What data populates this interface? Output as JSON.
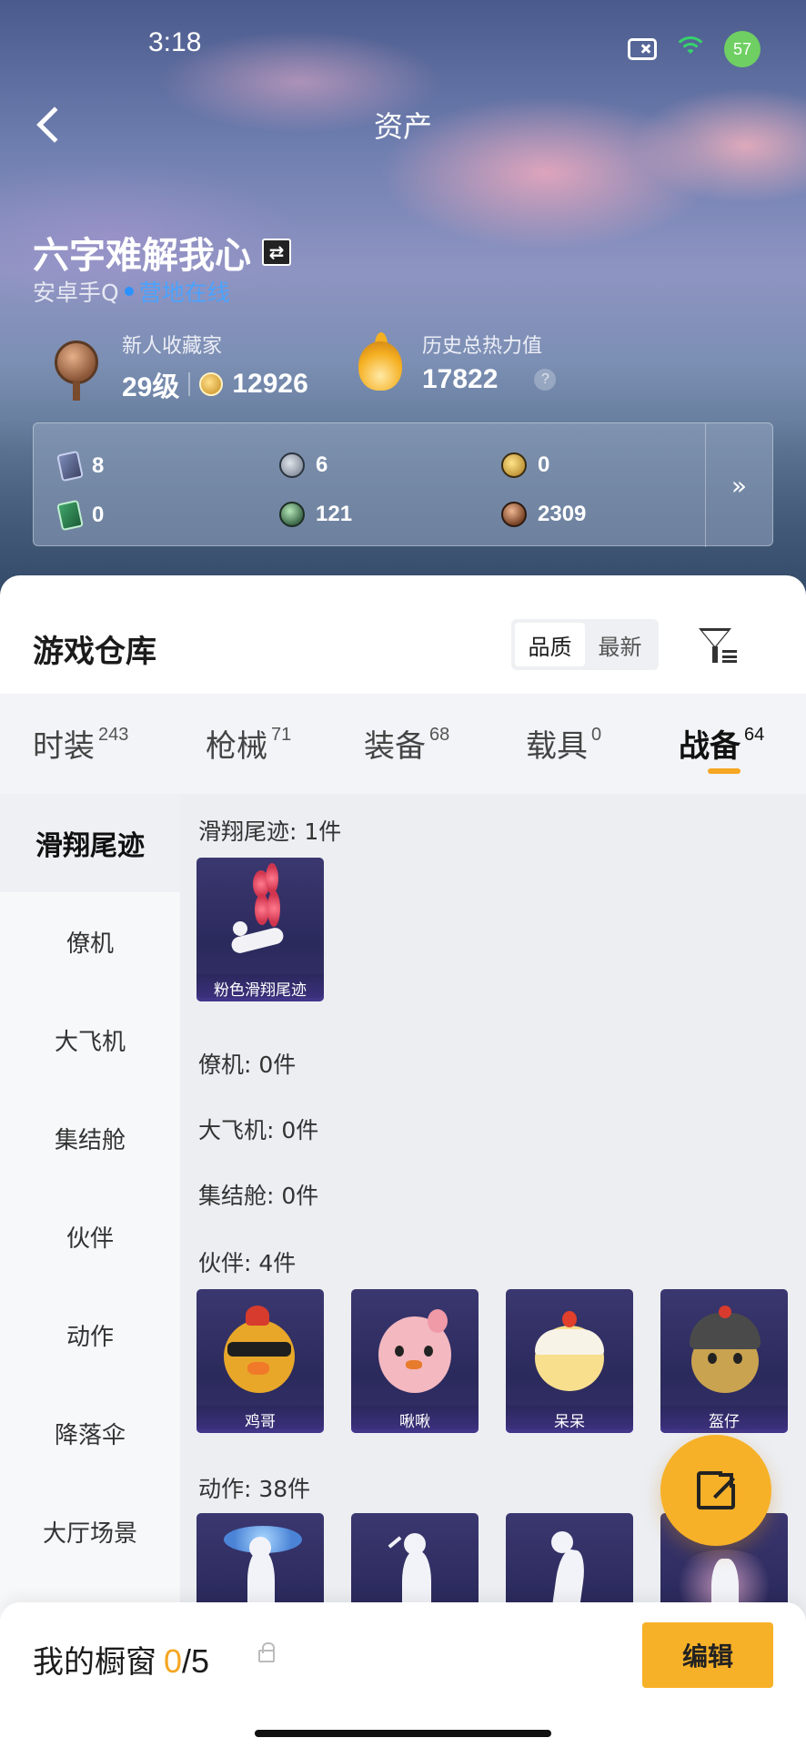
{
  "status_bar": {
    "time": "3:18",
    "battery": "57"
  },
  "nav": {
    "title": "资产"
  },
  "player": {
    "name": "六字难解我心",
    "platform": "安卓手Q",
    "status": "营地在线",
    "rank_title": "新人收藏家",
    "level": "29级",
    "coins": "12926",
    "heat_title": "历史总热力值",
    "heat_value": "17822",
    "help": "?"
  },
  "currencies": [
    {
      "icon": "card-coupon-icon",
      "value": "8"
    },
    {
      "icon": "silver-coin-icon",
      "value": "6"
    },
    {
      "icon": "gold-coin-icon",
      "value": "0"
    },
    {
      "icon": "green-card-icon",
      "value": "0"
    },
    {
      "icon": "orb-icon",
      "value": "121"
    },
    {
      "icon": "bronze-coin-icon",
      "value": "2309"
    }
  ],
  "currency_more": "»",
  "warehouse": {
    "title": "游戏仓库",
    "sort_options": [
      "品质",
      "最新"
    ],
    "sort_selected": "品质"
  },
  "category_tabs": [
    {
      "label": "时装",
      "count": "243"
    },
    {
      "label": "枪械",
      "count": "71"
    },
    {
      "label": "装备",
      "count": "68"
    },
    {
      "label": "载具",
      "count": "0"
    },
    {
      "label": "战备",
      "count": "64"
    }
  ],
  "category_active": "战备",
  "side_nav": [
    "滑翔尾迹",
    "僚机",
    "大飞机",
    "集结舱",
    "伙伴",
    "动作",
    "降落伞",
    "大厅场景"
  ],
  "side_nav_active": "滑翔尾迹",
  "sections": {
    "trail": {
      "title": "滑翔尾迹: 1件",
      "items": [
        "粉色滑翔尾迹"
      ]
    },
    "wingman": {
      "title": "僚机: 0件"
    },
    "plane": {
      "title": "大飞机: 0件"
    },
    "pod": {
      "title": "集结舱: 0件"
    },
    "partner": {
      "title": "伙伴: 4件",
      "items": [
        "鸡哥",
        "啾啾",
        "呆呆",
        "盔仔"
      ]
    },
    "emote": {
      "title": "动作: 38件"
    }
  },
  "showcase": {
    "title": "我的橱窗",
    "current": "0",
    "total": "/5",
    "edit_label": "编辑"
  },
  "colors": {
    "accent": "#f7b128",
    "online": "#2c92ff",
    "card_bg": "#2b2a5c"
  }
}
